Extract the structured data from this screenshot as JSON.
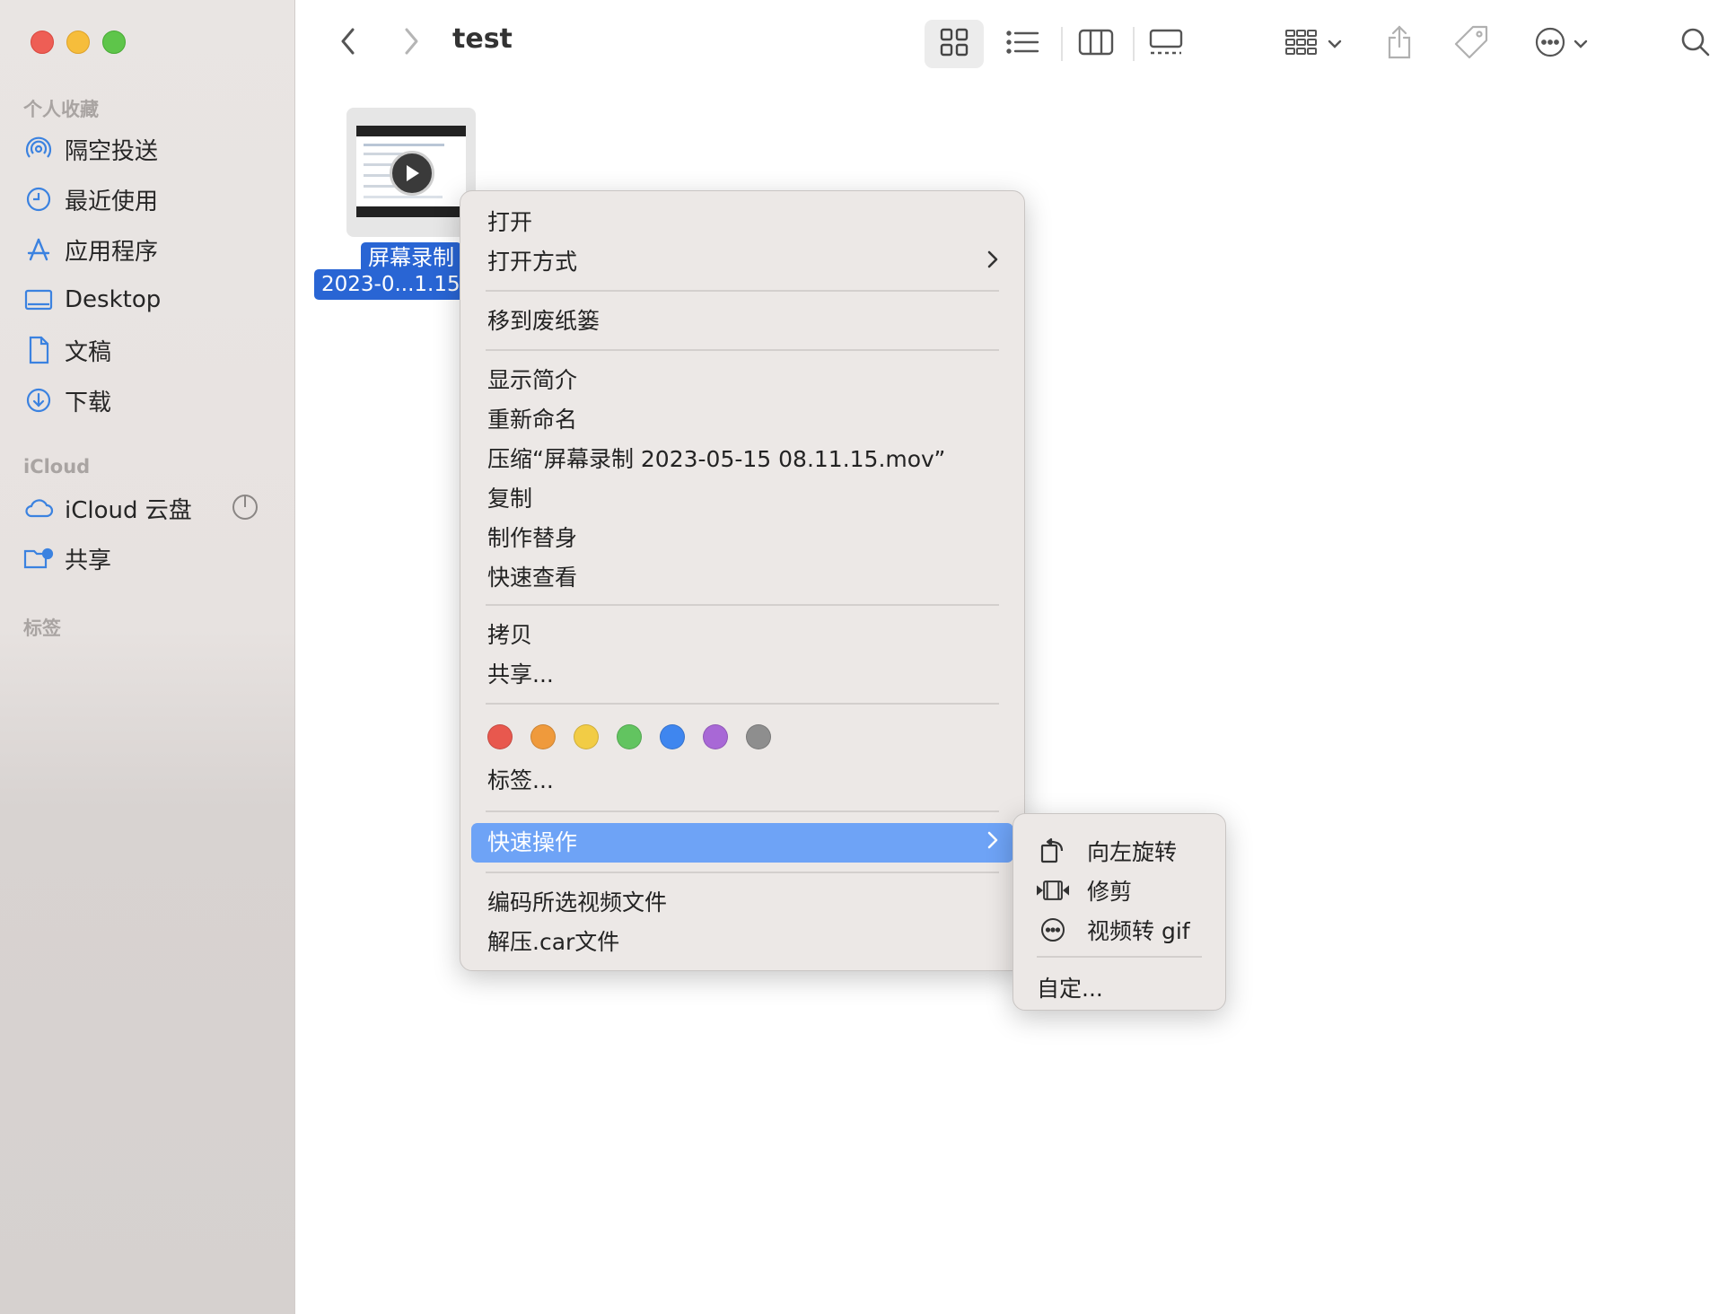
{
  "window": {
    "title": "test"
  },
  "sidebar": {
    "favorites_header": "个人收藏",
    "favorites": [
      {
        "label": "隔空投送",
        "icon": "airdrop-icon"
      },
      {
        "label": "最近使用",
        "icon": "clock-icon"
      },
      {
        "label": "应用程序",
        "icon": "applications-icon"
      },
      {
        "label": "Desktop",
        "icon": "desktop-icon"
      },
      {
        "label": "文稿",
        "icon": "document-icon"
      },
      {
        "label": "下载",
        "icon": "download-icon"
      }
    ],
    "icloud_header": "iCloud",
    "icloud": [
      {
        "label": "iCloud 云盘",
        "icon": "cloud-icon"
      },
      {
        "label": "共享",
        "icon": "shared-folder-icon"
      }
    ],
    "tags_header": "标签"
  },
  "file": {
    "name_line1": "屏幕录制",
    "name_line2": "2023-0...1.15.mov"
  },
  "context_menu": {
    "open": "打开",
    "open_with": "打开方式",
    "move_to_trash": "移到废纸篓",
    "get_info": "显示简介",
    "rename": "重新命名",
    "compress": "压缩“屏幕录制 2023-05-15 08.11.15.mov”",
    "duplicate": "复制",
    "make_alias": "制作替身",
    "quick_look": "快速查看",
    "copy": "拷贝",
    "share": "共享...",
    "tags": "标签...",
    "quick_actions": "快速操作",
    "encode_video": "编码所选视频文件",
    "decompress_car": "解压.car文件",
    "tag_colors": [
      "#e8584e",
      "#ef9a3c",
      "#f2cc45",
      "#62c460",
      "#3f86ef",
      "#a868d6",
      "#8e8e8e"
    ]
  },
  "quick_actions_submenu": {
    "rotate_left": "向左旋转",
    "trim": "修剪",
    "video_to_gif": "视频转 gif",
    "customize": "自定..."
  }
}
